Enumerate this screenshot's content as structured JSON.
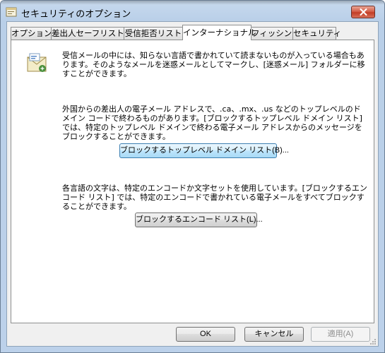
{
  "window": {
    "title": "セキュリティのオプション",
    "title_icon": "options-icon",
    "close_icon": "close-icon"
  },
  "tabs": [
    {
      "label": "オプション",
      "active": false
    },
    {
      "label": "差出人セーフリスト",
      "active": false
    },
    {
      "label": "受信拒否リスト",
      "active": false
    },
    {
      "label": "インターナショナル",
      "active": true
    },
    {
      "label": "フィッシング",
      "active": false
    },
    {
      "label": "セキュリティ",
      "active": false
    }
  ],
  "international": {
    "icon": "mail-envelope-icon",
    "intro": "受信メールの中には、知らない言語で書かれていて読まないものが入っている場合もあります。そのようなメールを迷惑メールとしてマークし、[迷惑メール] フォルダーに移すことができます。",
    "domains_text": "外国からの差出人の電子メール アドレスで、.ca、.mx、.us などのトップレベルのドメイン コードで終わるものがあります。[ブロックするトップレベル ドメイン リスト] では、特定のトップレベル ドメインで終わる電子メール アドレスからのメッセージをブロックすることができます。",
    "domains_button": "ブロックするトップレベル ドメイン リスト(B)...",
    "encodings_text": "各言語の文字は、特定のエンコードか文字セットを使用しています。[ブロックするエンコード リスト] では、特定のエンコードで書かれている電子メールをすべてブロックすることができます。",
    "encodings_button": "ブロックするエンコード リスト(L)..."
  },
  "footer": {
    "ok": "OK",
    "cancel": "キャンセル",
    "apply": "適用(A)"
  },
  "colors": {
    "frame": "#c7d9ee",
    "close": "#c94a31",
    "focus_button": "#bee6fd"
  }
}
